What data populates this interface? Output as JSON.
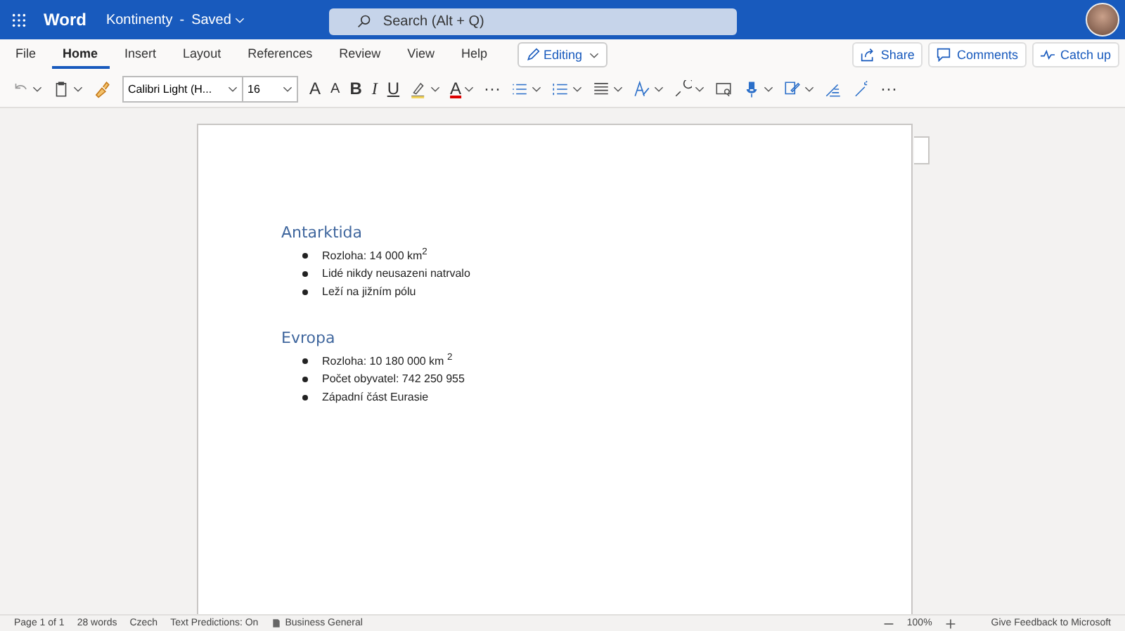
{
  "titlebar": {
    "app_name": "Word",
    "document_name": "Kontinenty",
    "separator": "-",
    "status": "Saved",
    "search_placeholder": "Search (Alt + Q)"
  },
  "tabs": [
    {
      "label": "File",
      "selected": false
    },
    {
      "label": "Home",
      "selected": true
    },
    {
      "label": "Insert",
      "selected": false
    },
    {
      "label": "Layout",
      "selected": false
    },
    {
      "label": "References",
      "selected": false
    },
    {
      "label": "Review",
      "selected": false
    },
    {
      "label": "View",
      "selected": false
    },
    {
      "label": "Help",
      "selected": false
    }
  ],
  "mode": "Editing",
  "actions": [
    {
      "kind": "share",
      "label": "Share"
    },
    {
      "kind": "comments",
      "label": "Comments"
    },
    {
      "kind": "catchup",
      "label": "Catch up"
    }
  ],
  "toolbar": {
    "font": "Calibri Light (H...",
    "size": "16",
    "items": [
      {
        "kind": "undo",
        "dropdown": true
      },
      {
        "kind": "clipboard",
        "dropdown": true
      },
      {
        "kind": "painter",
        "dropdown": false
      },
      {
        "kind": "fontbox"
      },
      {
        "kind": "grow",
        "text": "A"
      },
      {
        "kind": "shrink",
        "text": "A"
      },
      {
        "kind": "bold",
        "text": "B"
      },
      {
        "kind": "italic",
        "text": "I"
      },
      {
        "kind": "underline",
        "text": "U"
      },
      {
        "kind": "highlight",
        "dropdown": true
      },
      {
        "kind": "fontcolor",
        "text": "A",
        "dropdown": true
      },
      {
        "kind": "more",
        "text": "···"
      },
      {
        "kind": "bullets",
        "dropdown": true
      },
      {
        "kind": "numbering",
        "dropdown": true
      },
      {
        "kind": "align",
        "dropdown": true
      },
      {
        "kind": "styles",
        "dropdown": true
      },
      {
        "kind": "find",
        "dropdown": true
      },
      {
        "kind": "review",
        "dropdown": false
      },
      {
        "kind": "dictate",
        "dropdown": true
      },
      {
        "kind": "editor",
        "dropdown": true
      },
      {
        "kind": "designer",
        "dropdown": false
      },
      {
        "kind": "wand",
        "dropdown": false
      },
      {
        "kind": "more",
        "text": "···"
      }
    ]
  },
  "document": {
    "sections": [
      {
        "heading": "Antarktida",
        "bullets": [
          "Rozloha: 14 000 km$^{2}$",
          "Lidé nikdy neusazeni natrvalo",
          "Leží na jižním pólu"
        ]
      },
      {
        "heading": "Evropa",
        "bullets": [
          "Rozloha: 10 180 000 km $^{2}$",
          "Počet obyvatel: 742 250 955",
          "Západní část Eurasie"
        ]
      }
    ]
  },
  "status_bar": {
    "items": [
      "Page 1 of 1",
      "28 words",
      "Czech",
      "Text Predictions: On"
    ],
    "label": "Business General",
    "zoom": "100%",
    "feedback": "Give Feedback to Microsoft"
  }
}
